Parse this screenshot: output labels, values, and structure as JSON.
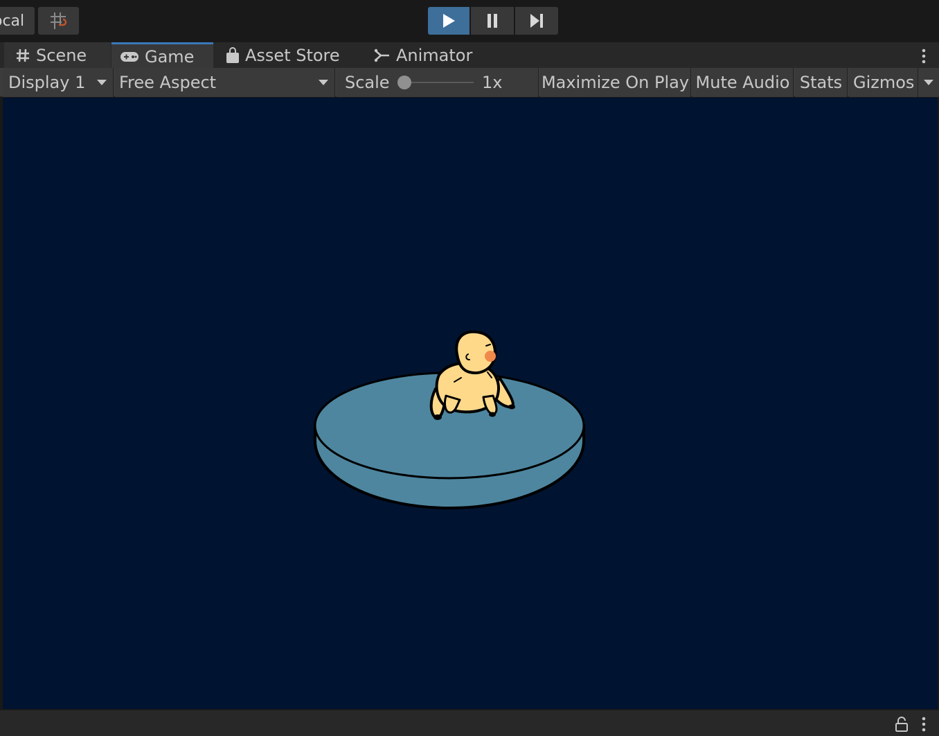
{
  "toolbar": {
    "pivot_label": "ocal",
    "play_icon": "play-icon",
    "pause_icon": "pause-icon",
    "step_icon": "step-icon",
    "grid_icon": "grid-snap-icon"
  },
  "tabs": [
    {
      "label": "Scene",
      "icon": "hash-icon"
    },
    {
      "label": "Game",
      "icon": "gamepad-icon",
      "active": true
    },
    {
      "label": "Asset Store",
      "icon": "shopping-bag-icon"
    },
    {
      "label": "Animator",
      "icon": "animator-icon"
    }
  ],
  "game_toolbar": {
    "display": "Display 1",
    "aspect": "Free Aspect",
    "scale_label": "Scale",
    "scale_value": "1x",
    "scale_fraction": 0.0,
    "maximize": "Maximize On Play",
    "mute": "Mute Audio",
    "stats": "Stats",
    "gizmos": "Gizmos"
  },
  "colors": {
    "play_active": "#3e6e9a",
    "viewport_bg": "#001330",
    "platform": "#4e869f",
    "character": "#ffd98a",
    "tab_accent": "#3a79bb"
  }
}
